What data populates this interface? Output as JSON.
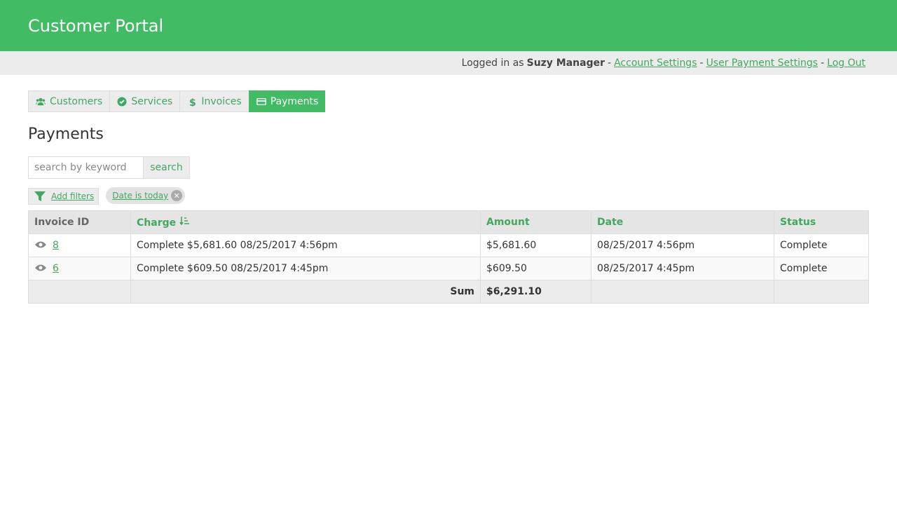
{
  "header": {
    "title": "Customer Portal"
  },
  "userbar": {
    "prefix": "Logged in as",
    "user": "Suzy Manager",
    "sep": "-",
    "links": [
      "Account Settings",
      "User Payment Settings",
      "Log Out"
    ]
  },
  "tabs": [
    {
      "label": "Customers",
      "icon": "users-icon"
    },
    {
      "label": "Services",
      "icon": "check-circle-icon"
    },
    {
      "label": "Invoices",
      "icon": "dollar-icon"
    },
    {
      "label": "Payments",
      "icon": "credit-card-icon",
      "active": true
    }
  ],
  "page_title": "Payments",
  "search": {
    "placeholder": "search by keyword",
    "value": "",
    "button": "search"
  },
  "filters": {
    "add_label": "Add filters",
    "active": [
      {
        "label": "Date is today"
      }
    ]
  },
  "table": {
    "headers": [
      "Invoice ID",
      "Charge",
      "Amount",
      "Date",
      "Status"
    ],
    "rows": [
      {
        "id": "8",
        "charge": "Complete $5,681.60 08/25/2017 4:56pm",
        "amount": "$5,681.60",
        "date": "08/25/2017 4:56pm",
        "status": "Complete"
      },
      {
        "id": "6",
        "charge": "Complete $609.50 08/25/2017 4:45pm",
        "amount": "$609.50",
        "date": "08/25/2017 4:45pm",
        "status": "Complete"
      }
    ],
    "sum_label": "Sum",
    "sum_value": "$6,291.10"
  },
  "colors": {
    "brand": "#41bb64",
    "link": "#41a85f"
  }
}
